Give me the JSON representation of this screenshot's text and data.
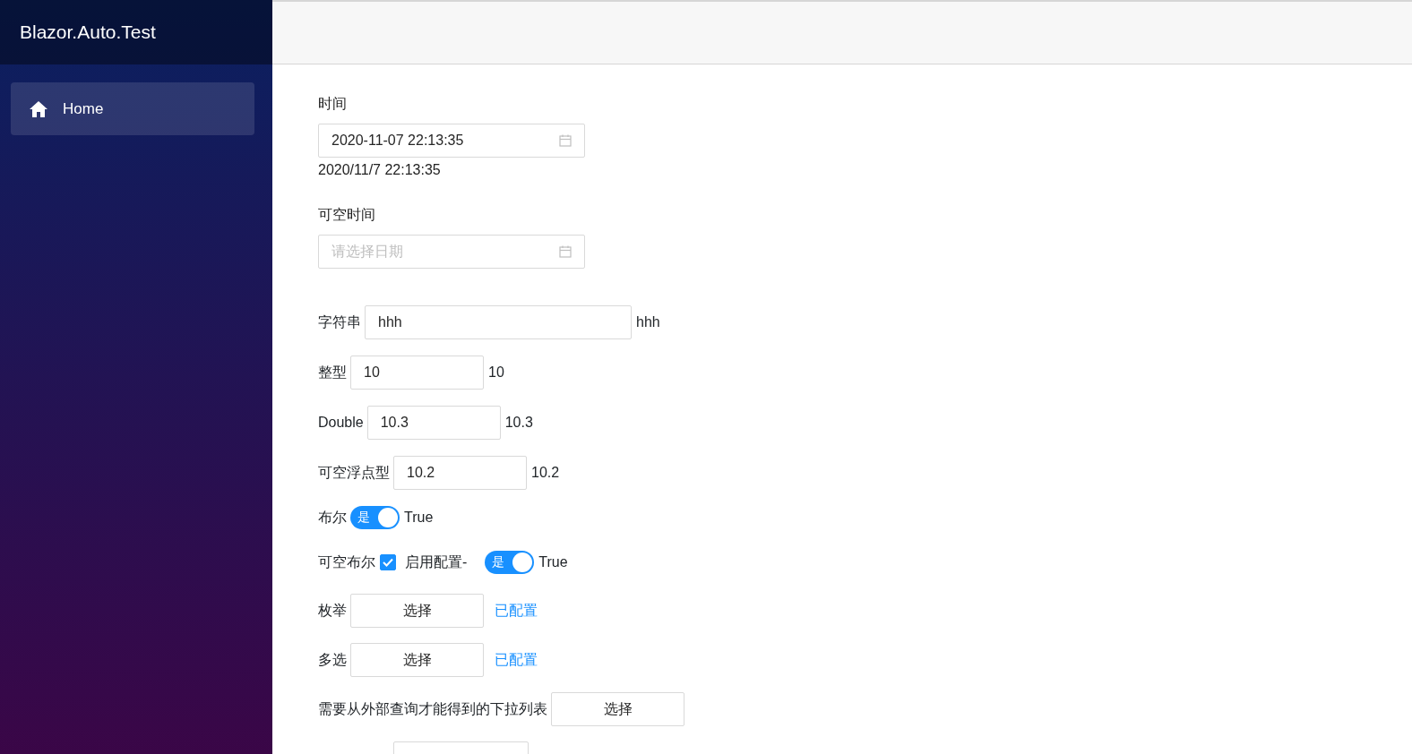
{
  "sidebar": {
    "brand": "Blazor.Auto.Test",
    "items": [
      {
        "label": "Home",
        "selected": true
      }
    ]
  },
  "form": [
    {
      "kind": "date",
      "label": "时间",
      "value": "2020-11-07 22:13:35",
      "display": "2020/11/7 22:13:35"
    },
    {
      "kind": "date",
      "label": "可空时间",
      "placeholder": "请选择日期"
    },
    {
      "kind": "text-input",
      "label": "字符串",
      "value": "hhh",
      "display": "hhh"
    },
    {
      "kind": "input",
      "label": "整型",
      "value": "10",
      "display": "10"
    },
    {
      "kind": "input",
      "label": "Double",
      "value": "10.3",
      "display": "10.3"
    },
    {
      "kind": "input",
      "label": "可空浮点型",
      "value": "10.2",
      "display": "10.2"
    },
    {
      "kind": "switch",
      "label": "布尔",
      "on": true,
      "switch_text": "是",
      "display": "True"
    },
    {
      "kind": "nullable-switch",
      "label": "可空布尔",
      "checked": true,
      "checkbox_label": "启用配置-",
      "on": true,
      "switch_text": "是",
      "display": "True"
    },
    {
      "kind": "select",
      "label": "枚举",
      "button": "选择",
      "status": "已配置"
    },
    {
      "kind": "select",
      "label": "多选",
      "button": "选择",
      "status": "已配置"
    },
    {
      "kind": "select",
      "label": "需要从外部查询才能得到的下拉列表",
      "button": "选择"
    },
    {
      "kind": "cut-off"
    }
  ]
}
